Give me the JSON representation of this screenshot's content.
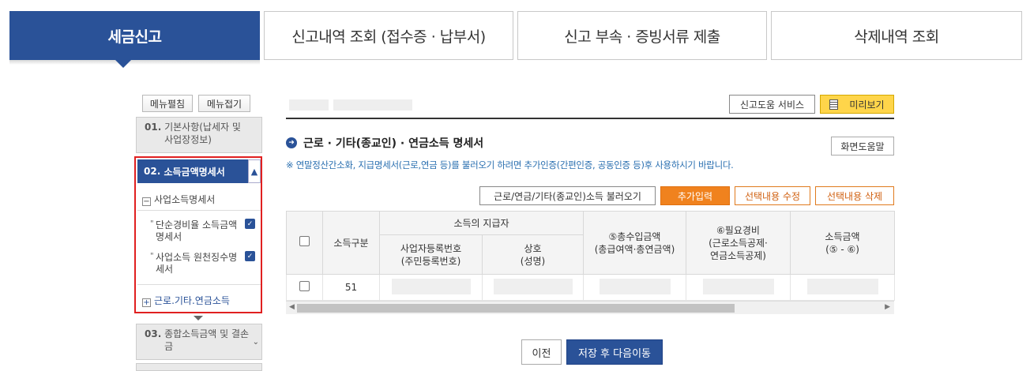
{
  "topnav": {
    "tabs": [
      {
        "label": "세금신고",
        "active": true
      },
      {
        "label": "신고내역 조회 (접수증 · 납부서)",
        "active": false
      },
      {
        "label": "신고 부속 · 증빙서류 제출",
        "active": false
      },
      {
        "label": "삭제내역 조회",
        "active": false
      }
    ]
  },
  "sidebar": {
    "expand_label": "메뉴펼침",
    "collapse_label": "메뉴접기",
    "step1": {
      "num": "01.",
      "label": "기본사항(납세자 및 사업장정보)"
    },
    "step2": {
      "num": "02.",
      "label": "소득금액명세서"
    },
    "tree": {
      "business_income": "사업소득명세서",
      "sub_item_1": "단순경비율 소득금액명세서",
      "sub_item_2": "사업소득 원천징수명세서",
      "wage_income": "근로.기타.연금소득"
    },
    "step3": {
      "num": "03.",
      "label": "종합소득금액 및 결손금"
    }
  },
  "main": {
    "help_service_label": "신고도움 서비스",
    "preview_label": "미리보기",
    "section_title": "근로 · 기타(종교인) · 연금소득 명세서",
    "screen_help_label": "화면도움말",
    "notice": "※ 연말정산간소화, 지급명세서(근로,연금 등)를 불러오기 하려면 추가인증(간편인증, 공동인증 등)후 사용하시기 바랍니다.",
    "load_button": "근로/연금/기타(종교인)소득 불러오기",
    "add_button": "추가입력",
    "edit_button": "선택내용 수정",
    "delete_button": "선택내용 삭제"
  },
  "table": {
    "headers": {
      "income_type": "소득구분",
      "payer": "소득의 지급자",
      "biz_reg_no": "사업자등록번호\n(주민등록번호)",
      "name": "상호\n(성명)",
      "total_income": "⑤총수입금액\n(총급여액·총연금액)",
      "expenses": "⑥필요경비\n(근로소득공제·\n연금소득공제)",
      "income_amount": "소득금액\n(⑤ - ⑥)"
    },
    "rows": [
      {
        "income_type": "51"
      }
    ]
  },
  "footer": {
    "prev_label": "이전",
    "next_label": "저장 후 다음이동"
  },
  "colors": {
    "primary": "#2a5298",
    "accent_orange": "#f0821e",
    "highlight_red": "#e02020",
    "preview_yellow": "#ffd54a"
  }
}
